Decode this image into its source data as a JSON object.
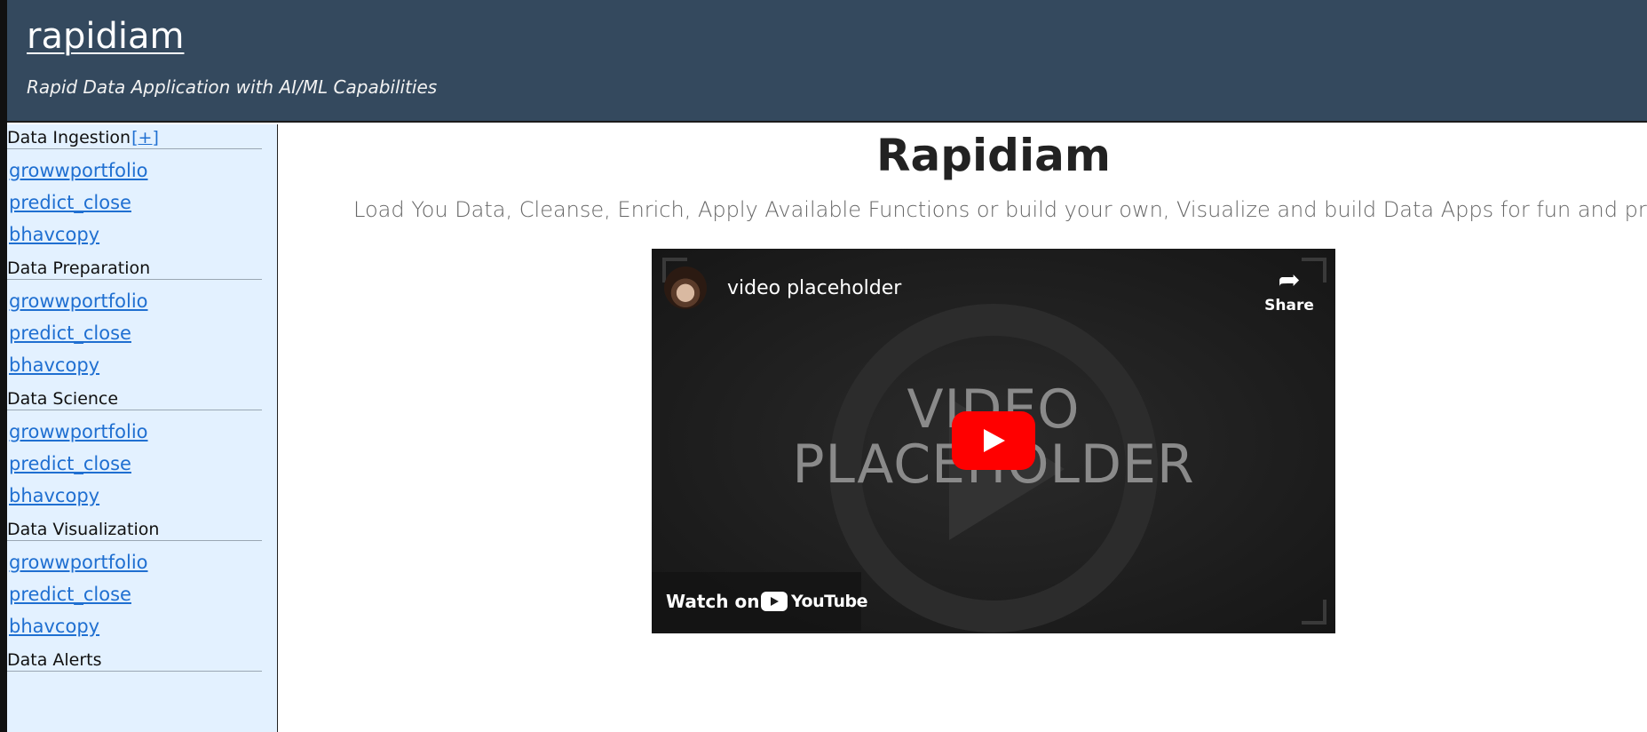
{
  "header": {
    "site_title": "rapidiam",
    "tagline": "Rapid Data Application with AI/ML Capabilities",
    "background_color": "#34495e"
  },
  "sidebar": {
    "background_color": "#e3f1ff",
    "toggle_label": "[+]",
    "sections": [
      {
        "title": "Data Ingestion",
        "links": [
          "growwportfolio",
          "predict_close",
          "bhavcopy"
        ]
      },
      {
        "title": "Data Preparation",
        "links": [
          "growwportfolio",
          "predict_close",
          "bhavcopy"
        ]
      },
      {
        "title": "Data Science",
        "links": [
          "growwportfolio",
          "predict_close",
          "bhavcopy"
        ]
      },
      {
        "title": "Data Visualization",
        "links": [
          "growwportfolio",
          "predict_close",
          "bhavcopy"
        ]
      },
      {
        "title": "Data Alerts",
        "links": []
      }
    ]
  },
  "main": {
    "title": "Rapidiam",
    "lead": "Load You Data, Cleanse, Enrich, Apply Available Functions or build your own, Visualize and build Data Apps for fun and profit."
  },
  "video": {
    "title": "video placeholder",
    "share_label": "Share",
    "placeholder_line1": "VIDEO",
    "placeholder_line2": "PLACEHOLDER",
    "watch_on_label": "Watch on",
    "platform_name": "YouTube",
    "play_button_color": "#ff0000",
    "icons": [
      "share-icon",
      "play-icon",
      "youtube-logo-icon"
    ]
  }
}
